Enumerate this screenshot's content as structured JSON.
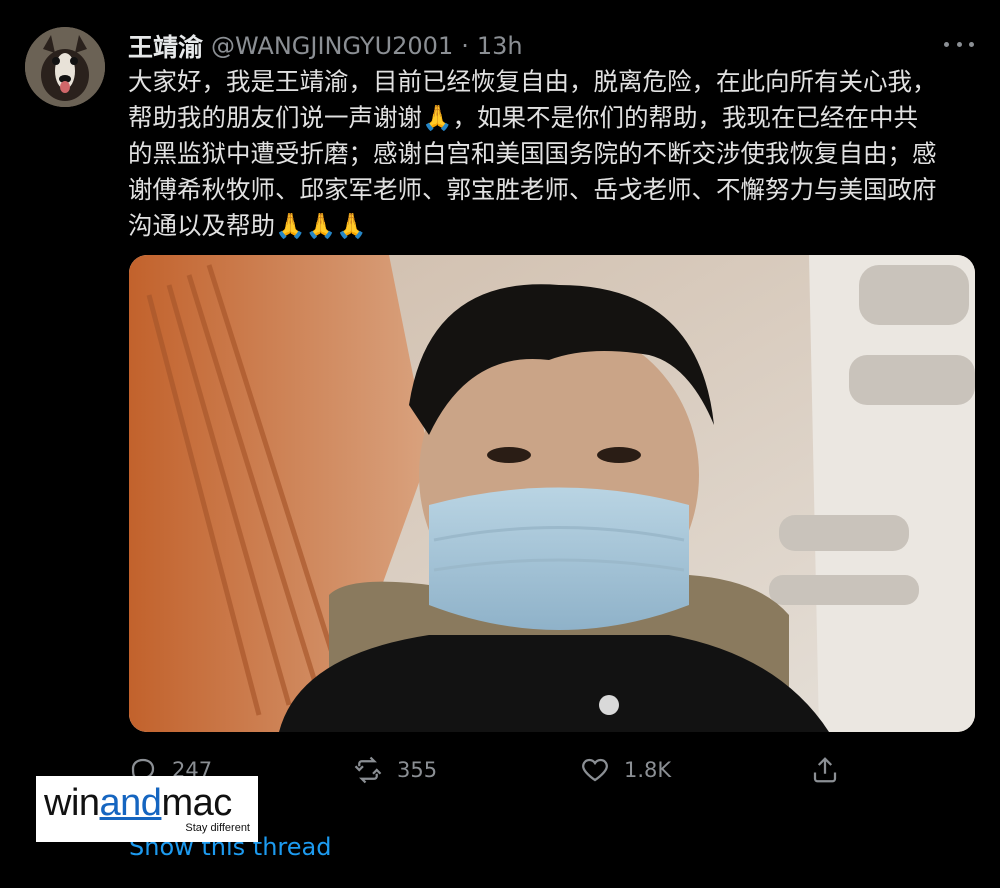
{
  "tweet": {
    "display_name": "王靖渝",
    "handle": "@WANGJINGYU2001",
    "separator": "·",
    "time": "13h",
    "text_lines": [
      "大家好，我是王靖渝，目前已经恢复自由，脱离危险，在此向所有关心我，",
      "帮助我的朋友们说一声谢谢🙏，如果不是你们的帮助，我现在已经在中共",
      "的黑监狱中遭受折磨；感谢白宫和美国国务院的不断交涉使我恢复自由；感",
      "谢傅希秋牧师、邱家军老师、郭宝胜老师、岳戈老师、不懈努力与美国政府",
      "沟通以及帮助🙏🙏🙏"
    ],
    "media_icon": "photo-selfie-airplane-cabin-mask"
  },
  "actions": {
    "reply_count": "247",
    "retweet_count": "355",
    "like_count": "1.8K",
    "reply_icon": "reply-icon",
    "retweet_icon": "retweet-icon",
    "like_icon": "heart-icon",
    "share_icon": "share-icon"
  },
  "thread": {
    "show_thread_label": "Show this thread"
  },
  "watermark": {
    "logo_prefix": "win",
    "logo_accent": "and",
    "logo_suffix": "mac",
    "tagline": "Stay different"
  },
  "colors": {
    "background": "#000000",
    "link_blue": "#1d9bf0",
    "muted_gray": "#8b8f94",
    "logo_blue": "#1565c0"
  }
}
